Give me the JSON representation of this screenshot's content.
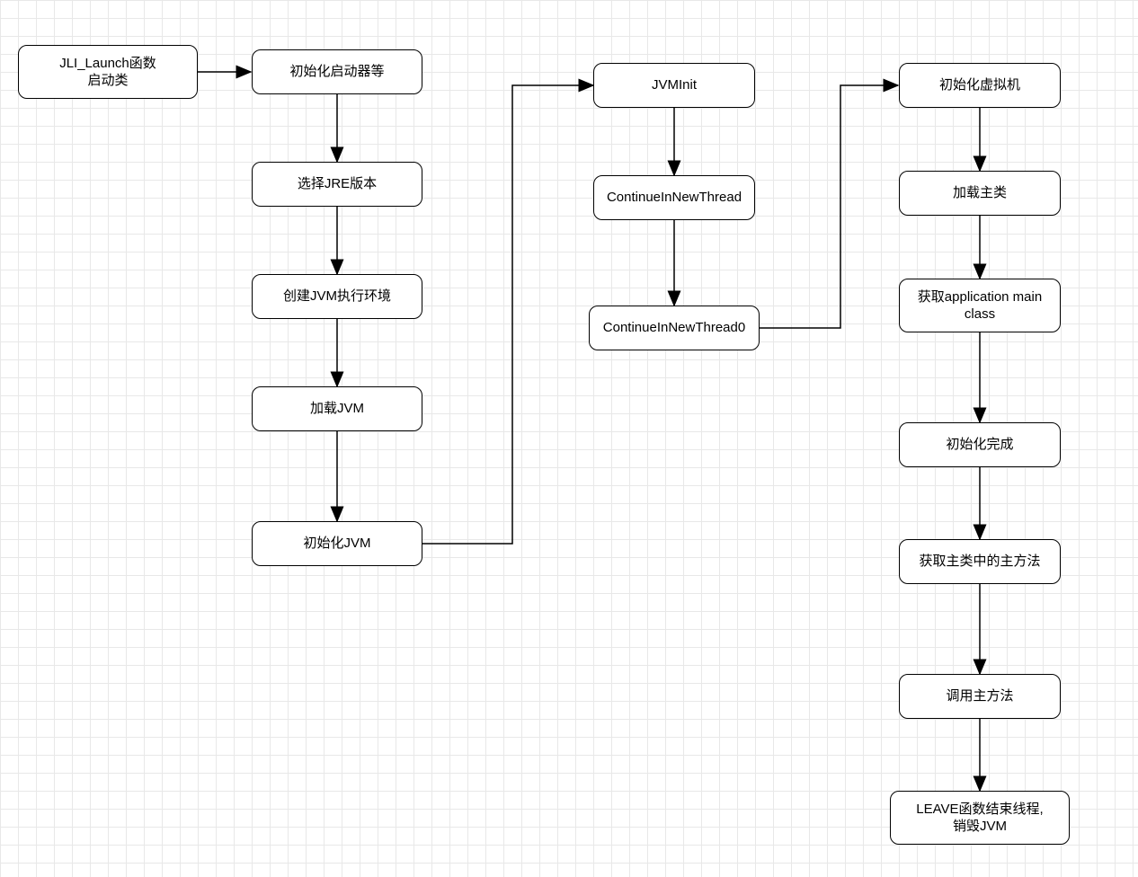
{
  "nodes": {
    "n1": "JLI_Launch函数\n启动类",
    "n2": "初始化启动器等",
    "n3": "选择JRE版本",
    "n4": "创建JVM执行环境",
    "n5": "加载JVM",
    "n6": "初始化JVM",
    "n7": "JVMInit",
    "n8": "ContinueInNewThread",
    "n9": "ContinueInNewThread0",
    "n10": "初始化虚拟机",
    "n11": "加载主类",
    "n12": "获取application main class",
    "n13": "初始化完成",
    "n14": "获取主类中的主方法",
    "n15": "调用主方法",
    "n16": "LEAVE函数结束线程,\n销毁JVM"
  },
  "flow_edges": [
    [
      "n1",
      "n2"
    ],
    [
      "n2",
      "n3"
    ],
    [
      "n3",
      "n4"
    ],
    [
      "n4",
      "n5"
    ],
    [
      "n5",
      "n6"
    ],
    [
      "n6",
      "n7"
    ],
    [
      "n7",
      "n8"
    ],
    [
      "n8",
      "n9"
    ],
    [
      "n9",
      "n10"
    ],
    [
      "n10",
      "n11"
    ],
    [
      "n11",
      "n12"
    ],
    [
      "n12",
      "n13"
    ],
    [
      "n13",
      "n14"
    ],
    [
      "n14",
      "n15"
    ],
    [
      "n15",
      "n16"
    ]
  ]
}
